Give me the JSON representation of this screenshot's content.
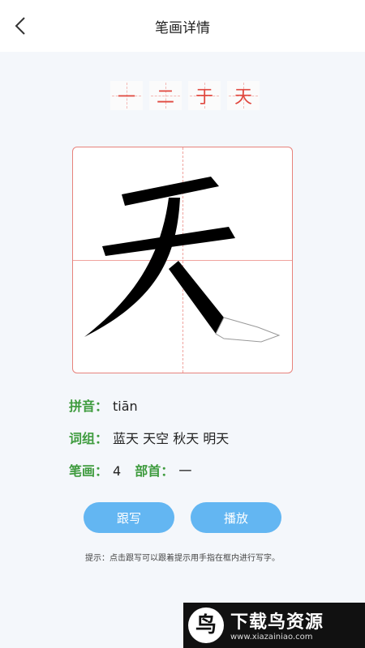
{
  "header": {
    "title": "笔画详情"
  },
  "strokes": [
    "一",
    "二",
    "于",
    "天"
  ],
  "character": "天",
  "info": {
    "pinyin_label": "拼音：",
    "pinyin": "tiān",
    "words_label": "词组：",
    "words": "蓝天 天空 秋天 明天",
    "strokes_label": "笔画：",
    "strokes_count": "4",
    "radical_label": "部首：",
    "radical": "一"
  },
  "buttons": {
    "trace": "跟写",
    "play": "播放"
  },
  "tip": "提示：点击跟写可以跟着提示用手指在框内进行写字。",
  "watermark": {
    "logo": "鸟",
    "name": "下载鸟资源",
    "url": "www.xiazainiao.com"
  },
  "colors": {
    "accent": "#63b6f2",
    "label_green": "#3e9b3e",
    "grid_red": "#e7827c",
    "stroke_red": "#e0483f"
  }
}
